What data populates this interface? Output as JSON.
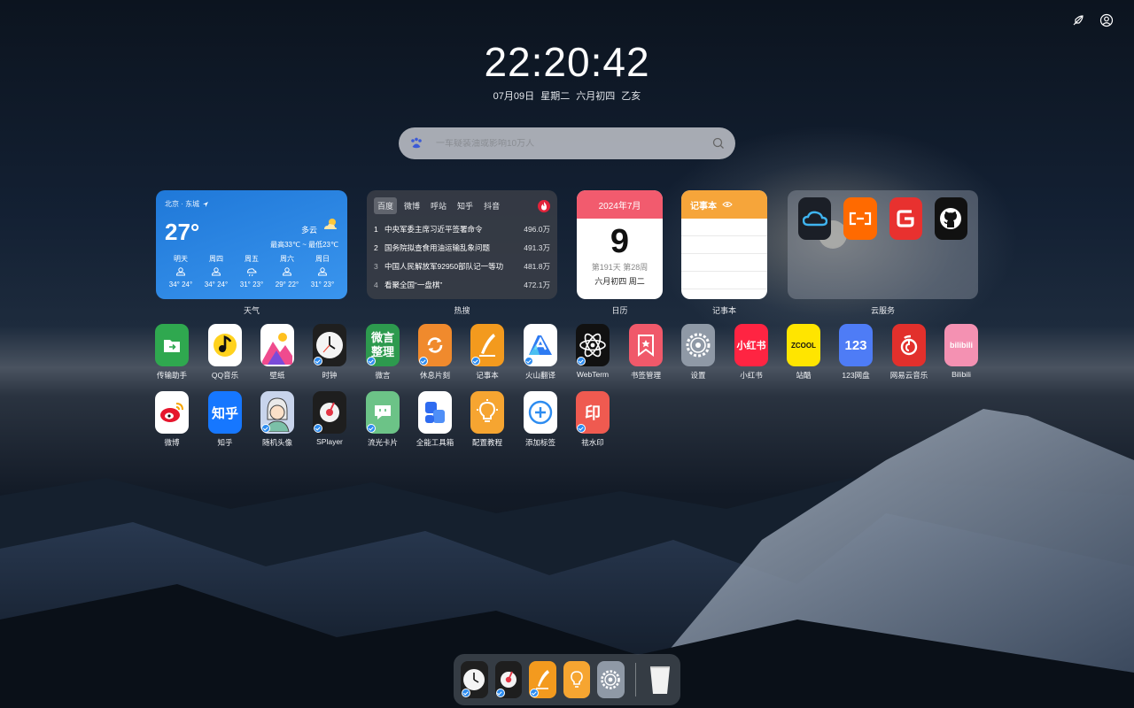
{
  "clock": {
    "time": "22:20:42",
    "date": "07月09日 星期二 六月初四 乙亥"
  },
  "search": {
    "placeholder": "一车疑装油或影响10万人"
  },
  "widgets": {
    "weather": {
      "location": "北京 · 东城",
      "temp": "27°",
      "condition": "多云",
      "range": "最高33℃ ~ 最低23℃",
      "forecast": [
        {
          "day": "明天",
          "temp": "34° 24°"
        },
        {
          "day": "周四",
          "temp": "34° 24°"
        },
        {
          "day": "周五",
          "temp": "31° 23°"
        },
        {
          "day": "周六",
          "temp": "29° 22°"
        },
        {
          "day": "周日",
          "temp": "31° 23°"
        }
      ],
      "label": "天气"
    },
    "hot": {
      "tabs": [
        "百度",
        "微博",
        "呼站",
        "知乎",
        "抖音"
      ],
      "items": [
        {
          "rank": "1",
          "title": "中央军委主席习近平签署命令",
          "value": "496.0万"
        },
        {
          "rank": "2",
          "title": "国务院拟查食用油运输乱象问题",
          "value": "491.3万"
        },
        {
          "rank": "3",
          "title": "中国人民解放军92950部队记一等功",
          "value": "481.8万"
        },
        {
          "rank": "4",
          "title": "看聚全国“一盘棋”",
          "value": "472.1万"
        }
      ],
      "label": "热搜"
    },
    "calendar": {
      "month": "2024年7月",
      "day": "9",
      "week": "第191天 第28周",
      "lunar": "六月初四 周二",
      "label": "日历"
    },
    "note": {
      "title": "记事本",
      "label": "记事本"
    },
    "cloud": {
      "label": "云服务"
    }
  },
  "apps_row1": [
    {
      "label": "传输助手",
      "icon": "transfer-icon",
      "color": "#2fa84f",
      "badge": false
    },
    {
      "label": "QQ音乐",
      "icon": "qqmusic-icon",
      "color": "#ffffff",
      "badge": false
    },
    {
      "label": "壁纸",
      "icon": "wallpaper-icon",
      "color": "#ffffff",
      "badge": false
    },
    {
      "label": "时钟",
      "icon": "clock-icon",
      "color": "#1f1f1f",
      "badge": true
    },
    {
      "label": "微言",
      "icon": "weiyan-icon",
      "color": "#2d9a4e",
      "badge": true
    },
    {
      "label": "休息片刻",
      "icon": "rest-icon",
      "color": "#f08a2d",
      "badge": true
    },
    {
      "label": "记事本",
      "icon": "notepad-icon",
      "color": "#f39a1e",
      "badge": true
    },
    {
      "label": "火山翻译",
      "icon": "translate-icon",
      "color": "#ffffff",
      "badge": true
    },
    {
      "label": "WebTerm",
      "icon": "webterm-icon",
      "color": "#111111",
      "badge": true
    },
    {
      "label": "书签管理",
      "icon": "bookmark-icon",
      "color": "#f0596a",
      "badge": false
    },
    {
      "label": "设置",
      "icon": "settings-icon",
      "color": "#8f99a6",
      "badge": false
    },
    {
      "label": "小红书",
      "icon": "xiaohongshu-icon",
      "color": "#ff2442",
      "badge": false
    },
    {
      "label": "站酷",
      "icon": "zcool-icon",
      "color": "#ffe500",
      "badge": false
    },
    {
      "label": "123网盘",
      "icon": "pan123-icon",
      "color": "#4e7cf6",
      "badge": false
    },
    {
      "label": "网易云音乐",
      "icon": "neteasemusic-icon",
      "color": "#e2302c",
      "badge": false
    },
    {
      "label": "Bilibili",
      "icon": "bilibili-icon",
      "color": "#f491b2",
      "badge": false
    }
  ],
  "apps_row2": [
    {
      "label": "微博",
      "icon": "weibo-icon",
      "color": "#ffffff",
      "badge": false
    },
    {
      "label": "知乎",
      "icon": "zhihu-icon",
      "color": "#1677ff",
      "badge": false
    },
    {
      "label": "随机头像",
      "icon": "avatar-icon",
      "color": "#c8d4ec",
      "badge": true
    },
    {
      "label": "SPlayer",
      "icon": "splayer-icon",
      "color": "#1e1e1e",
      "badge": true
    },
    {
      "label": "流光卡片",
      "icon": "cards-icon",
      "color": "#6cc387",
      "badge": true
    },
    {
      "label": "全能工具箱",
      "icon": "toolbox-icon",
      "color": "#ffffff",
      "badge": false
    },
    {
      "label": "配置教程",
      "icon": "tutorial-icon",
      "color": "#f6a531",
      "badge": false
    },
    {
      "label": "添加标签",
      "icon": "add-icon",
      "color": "#ffffff",
      "badge": false
    },
    {
      "label": "祛水印",
      "icon": "watermark-icon",
      "color": "#ef5a50",
      "badge": true
    }
  ],
  "dock": [
    {
      "icon": "clock-icon",
      "label": "时钟"
    },
    {
      "icon": "splayer-icon",
      "label": "SPlayer"
    },
    {
      "icon": "notepad-icon",
      "label": "记事本"
    },
    {
      "icon": "tutorial-icon",
      "label": "配置教程"
    },
    {
      "icon": "settings-icon",
      "label": "设置"
    },
    {
      "icon": "trash-icon",
      "label": "回收站"
    }
  ],
  "glyphs": {
    "weiyan": "微言",
    "weiyan2": "整理",
    "xhs": "小红书",
    "zcool": "ZCOOL",
    "pan123": "123",
    "bili": "bilibili",
    "zhihu": "知乎",
    "yin": "印"
  }
}
